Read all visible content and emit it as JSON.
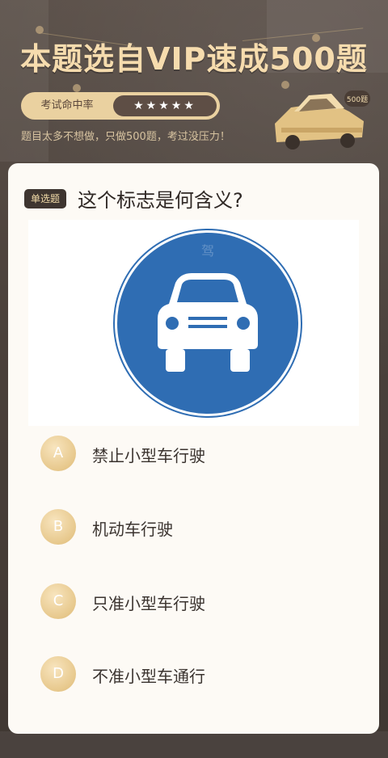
{
  "header": {
    "title": "本题选自VIP速成500题",
    "rate_label": "考试命中率",
    "rate_stars": "★★★★★",
    "subtitle": "题目太多不想做，只做500题，考过没压力！",
    "car_badge": "500题"
  },
  "question": {
    "type_badge": "单选题",
    "text": "这个标志是何含义?",
    "sign_icon": "motor-vehicle-lane-sign",
    "watermark": "驾"
  },
  "options": [
    {
      "letter": "A",
      "text": "禁止小型车行驶"
    },
    {
      "letter": "B",
      "text": "机动车行驶"
    },
    {
      "letter": "C",
      "text": "只准小型车行驶"
    },
    {
      "letter": "D",
      "text": "不准小型车通行"
    }
  ],
  "colors": {
    "title_gold": "#f6dcae",
    "sign_blue": "#2f6db3",
    "option_gold": "#e7c88c"
  }
}
